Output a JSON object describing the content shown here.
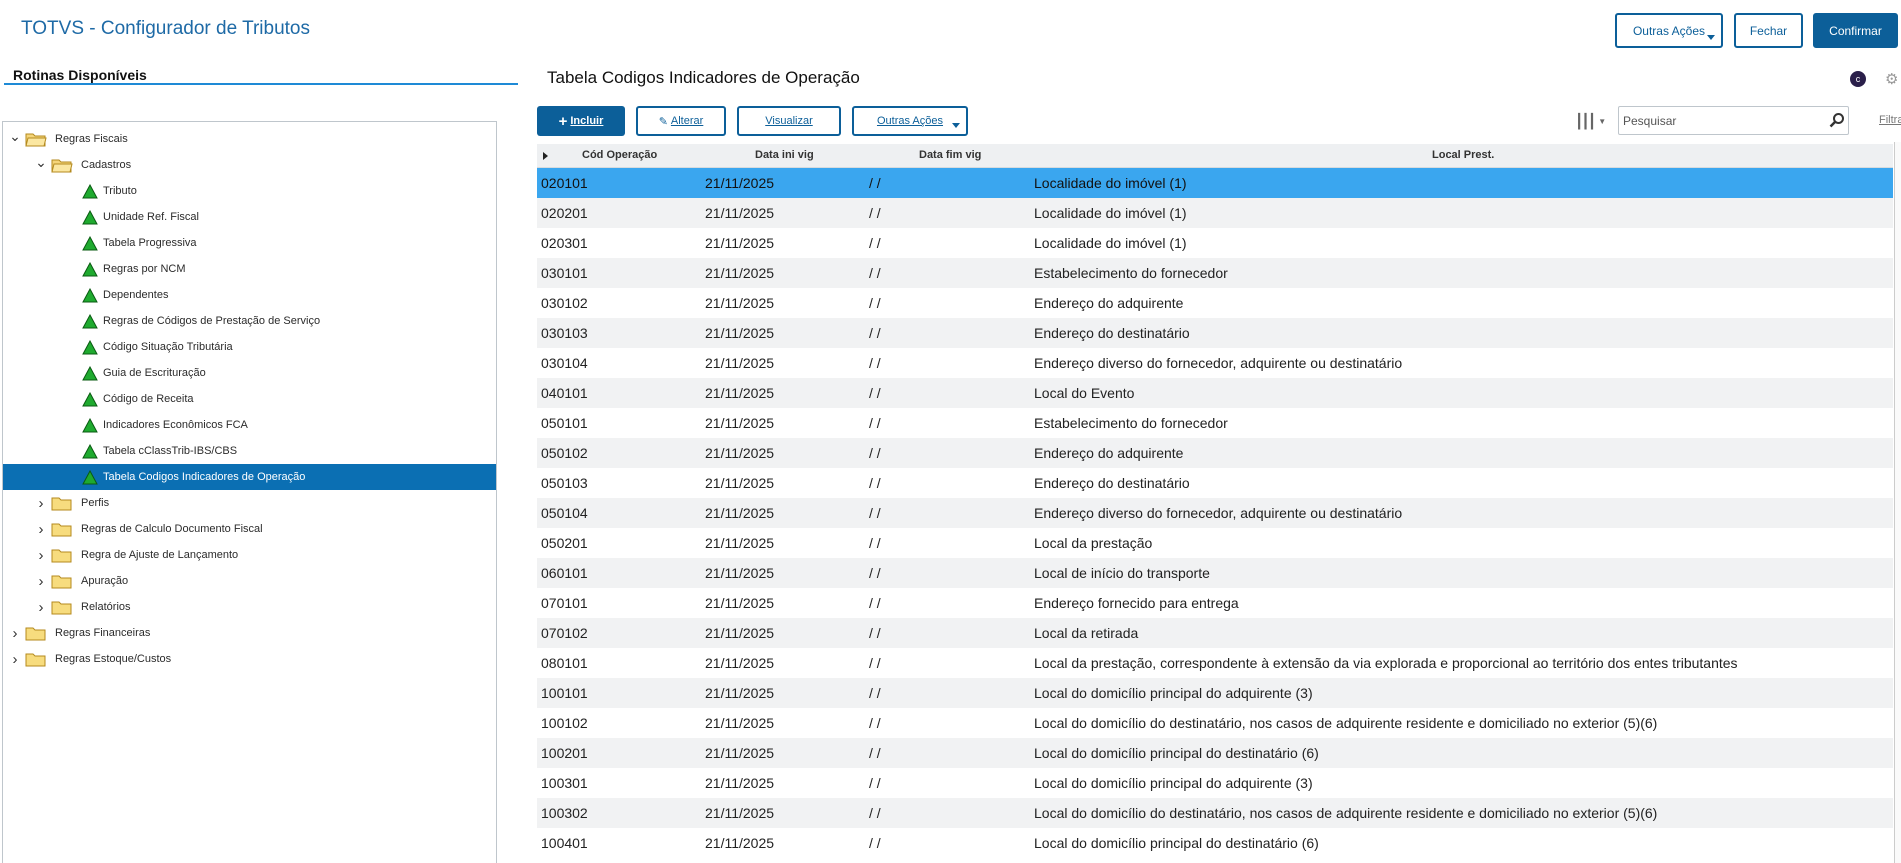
{
  "header": {
    "app_title": "TOTVS - Configurador de Tributos",
    "buttons": {
      "outras_acoes": "Outras Ações",
      "fechar": "Fechar",
      "confirmar": "Confirmar"
    }
  },
  "left": {
    "title": "Rotinas Disponíveis",
    "tree": [
      {
        "label": "Regras Fiscais",
        "level": 0,
        "type": "folder-open",
        "chev": "down"
      },
      {
        "label": "Cadastros",
        "level": 1,
        "type": "folder-open",
        "chev": "down"
      },
      {
        "label": "Tributo",
        "level": 2,
        "type": "routine"
      },
      {
        "label": "Unidade Ref. Fiscal",
        "level": 2,
        "type": "routine"
      },
      {
        "label": "Tabela Progressiva",
        "level": 2,
        "type": "routine"
      },
      {
        "label": "Regras por NCM",
        "level": 2,
        "type": "routine"
      },
      {
        "label": "Dependentes",
        "level": 2,
        "type": "routine"
      },
      {
        "label": "Regras de Códigos de Prestação de Serviço",
        "level": 2,
        "type": "routine"
      },
      {
        "label": "Código Situação Tributária",
        "level": 2,
        "type": "routine"
      },
      {
        "label": "Guia de Escrituração",
        "level": 2,
        "type": "routine"
      },
      {
        "label": "Código de Receita",
        "level": 2,
        "type": "routine"
      },
      {
        "label": "Indicadores Econômicos FCA",
        "level": 2,
        "type": "routine"
      },
      {
        "label": "Tabela cClassTrib-IBS/CBS",
        "level": 2,
        "type": "routine"
      },
      {
        "label": "Tabela Codigos Indicadores de Operação",
        "level": 2,
        "type": "routine",
        "selected": true
      },
      {
        "label": "Perfis",
        "level": 1,
        "type": "folder",
        "chev": "right"
      },
      {
        "label": "Regras de Calculo Documento Fiscal",
        "level": 1,
        "type": "folder",
        "chev": "right"
      },
      {
        "label": "Regra de Ajuste de Lançamento",
        "level": 1,
        "type": "folder",
        "chev": "right"
      },
      {
        "label": "Apuração",
        "level": 1,
        "type": "folder",
        "chev": "right"
      },
      {
        "label": "Relatórios",
        "level": 1,
        "type": "folder",
        "chev": "right"
      },
      {
        "label": "Regras Financeiras",
        "level": 0,
        "type": "folder",
        "chev": "right"
      },
      {
        "label": "Regras Estoque/Custos",
        "level": 0,
        "type": "folder",
        "chev": "right"
      }
    ]
  },
  "right": {
    "title": "Tabela Codigos Indicadores de Operação",
    "badge": "c",
    "toolbar": {
      "incluir": "Incluir",
      "alterar": "Alterar",
      "visualizar": "Visualizar",
      "outras_acoes": "Outras Ações"
    },
    "search_placeholder": "Pesquisar",
    "filter_label": "Filtra",
    "columns": [
      "Cód Operação",
      "Data ini vig",
      "Data fim vig",
      "Local Prest."
    ],
    "rows": [
      [
        "020101",
        "21/11/2025",
        "/ /",
        "Localidade do imóvel (1)"
      ],
      [
        "020201",
        "21/11/2025",
        "/ /",
        "Localidade do imóvel (1)"
      ],
      [
        "020301",
        "21/11/2025",
        "/ /",
        "Localidade do imóvel (1)"
      ],
      [
        "030101",
        "21/11/2025",
        "/ /",
        "Estabelecimento do fornecedor"
      ],
      [
        "030102",
        "21/11/2025",
        "/ /",
        "Endereço do adquirente"
      ],
      [
        "030103",
        "21/11/2025",
        "/ /",
        "Endereço do destinatário"
      ],
      [
        "030104",
        "21/11/2025",
        "/ /",
        "Endereço diverso do fornecedor, adquirente ou destinatário"
      ],
      [
        "040101",
        "21/11/2025",
        "/ /",
        "Local do Evento"
      ],
      [
        "050101",
        "21/11/2025",
        "/ /",
        "Estabelecimento do fornecedor"
      ],
      [
        "050102",
        "21/11/2025",
        "/ /",
        "Endereço do adquirente"
      ],
      [
        "050103",
        "21/11/2025",
        "/ /",
        "Endereço do destinatário"
      ],
      [
        "050104",
        "21/11/2025",
        "/ /",
        "Endereço diverso do fornecedor, adquirente ou destinatário"
      ],
      [
        "050201",
        "21/11/2025",
        "/ /",
        "Local da prestação"
      ],
      [
        "060101",
        "21/11/2025",
        "/ /",
        "Local de início do transporte"
      ],
      [
        "070101",
        "21/11/2025",
        "/ /",
        "Endereço fornecido para entrega"
      ],
      [
        "070102",
        "21/11/2025",
        "/ /",
        "Local da retirada"
      ],
      [
        "080101",
        "21/11/2025",
        "/ /",
        "Local da prestação, correspondente à extensão da via explorada e proporcional ao território dos entes tributantes"
      ],
      [
        "100101",
        "21/11/2025",
        "/ /",
        "Local do domicílio principal do adquirente (3)"
      ],
      [
        "100102",
        "21/11/2025",
        "/ /",
        "Local do domicílio do destinatário, nos casos de adquirente residente e domiciliado no exterior (5)(6)"
      ],
      [
        "100201",
        "21/11/2025",
        "/ /",
        "Local do domicílio principal do destinatário (6)"
      ],
      [
        "100301",
        "21/11/2025",
        "/ /",
        "Local do domicílio principal do adquirente (3)"
      ],
      [
        "100302",
        "21/11/2025",
        "/ /",
        "Local do domicílio do destinatário, nos casos de adquirente residente e domiciliado no exterior (5)(6)"
      ],
      [
        "100401",
        "21/11/2025",
        "/ /",
        "Local do domicílio principal do destinatário (6)"
      ]
    ]
  }
}
